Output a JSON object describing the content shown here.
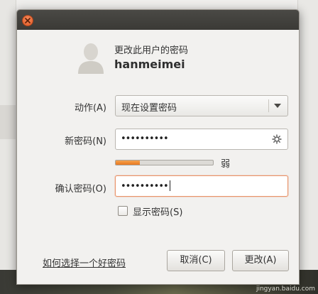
{
  "dialog": {
    "heading": "更改此用户的密码",
    "username": "hanmeimei"
  },
  "form": {
    "action_label": "动作(A)",
    "action_value": "现在设置密码",
    "new_password_label": "新密码(N)",
    "new_password_value": "••••••••••",
    "strength_text": "弱",
    "strength_fraction": 0.25,
    "confirm_label": "确认密码(O)",
    "confirm_value": "••••••••••",
    "show_password_label": "显示密码(S)",
    "show_password_checked": false
  },
  "footer": {
    "help_link": "如何选择一个好密码",
    "cancel_label": "取消(C)",
    "change_label": "更改(A)"
  },
  "watermark": "jingyan.baidu.com",
  "colors": {
    "titlebar": "#3b3a36",
    "close_button": "#e15a24",
    "focus_border": "#e9946a",
    "strength_fill": "#e8781f"
  },
  "icons": [
    "close-icon",
    "user-avatar-icon",
    "dropdown-arrow-icon",
    "generate-password-icon"
  ]
}
